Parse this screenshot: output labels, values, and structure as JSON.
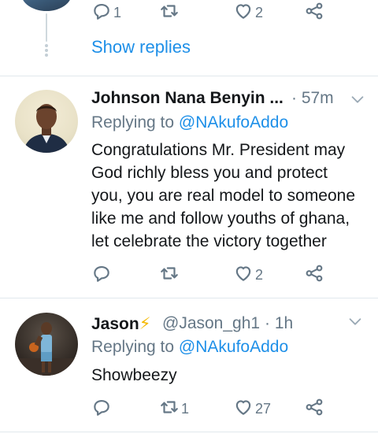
{
  "top_thread": {
    "reply_count": "1",
    "retweet_count": "",
    "like_count": "2",
    "show_replies_label": "Show replies"
  },
  "tweets": [
    {
      "display_name": "Johnson Nana Benyin ...",
      "time": "· 57m",
      "replying_prefix": "Replying to",
      "replying_to": "@NAkufoAddo",
      "text_lines": [
        "Congratulations Mr. President may",
        "God richly bless you and protect",
        "you, you are real model to someone",
        "like me and follow youths of ghana,",
        "let celebrate the victory together"
      ],
      "reply_count": "",
      "retweet_count": "",
      "like_count": "2"
    },
    {
      "display_name": "Jason",
      "name_emoji": "⚡",
      "handle": "@Jason_gh1",
      "time": "· 1h",
      "replying_prefix": "Replying to",
      "replying_to": "@NAkufoAddo",
      "text_lines": [
        "Showbeezy"
      ],
      "reply_count": "",
      "retweet_count": "1",
      "like_count": "27"
    }
  ],
  "icons": {
    "reply": "reply-icon",
    "retweet": "retweet-icon",
    "like": "heart-icon",
    "share": "share-icon",
    "menu": "chevron-down-icon"
  },
  "colors": {
    "link": "#1d8fe8",
    "muted": "#657786",
    "text": "#14171a",
    "divider": "#e1e8ed",
    "bolt": "#f5b800"
  }
}
